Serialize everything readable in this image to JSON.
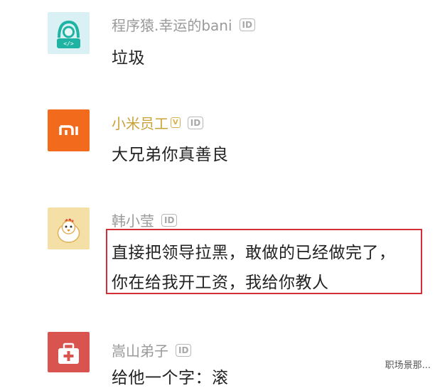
{
  "comments": [
    {
      "username": "程序猿.幸运的bani",
      "badge": "ID",
      "text": "垃圾",
      "avatar_icon": "programmer-icon",
      "avatar_color": "#d9f1f4"
    },
    {
      "username": "小米员工",
      "badge": "ID",
      "text": "大兄弟你真善良",
      "avatar_icon": "mi-logo-icon",
      "avatar_color": "#f26b1d",
      "avatar_label": "mi"
    },
    {
      "username": "韩小莹",
      "badge": "ID",
      "text_line1": "直接把领导拉黑，敢做的已经做完了，",
      "text_line2": "你在给我开工资，我给你教人",
      "avatar_icon": "chicken-icon",
      "avatar_color": "#f4e0a6"
    },
    {
      "username": "嵩山弟子",
      "badge": "ID",
      "text": "给他一个字：滚",
      "avatar_icon": "first-aid-kit-icon",
      "avatar_color": "#d9534f"
    }
  ],
  "watermark": "职场景那..."
}
